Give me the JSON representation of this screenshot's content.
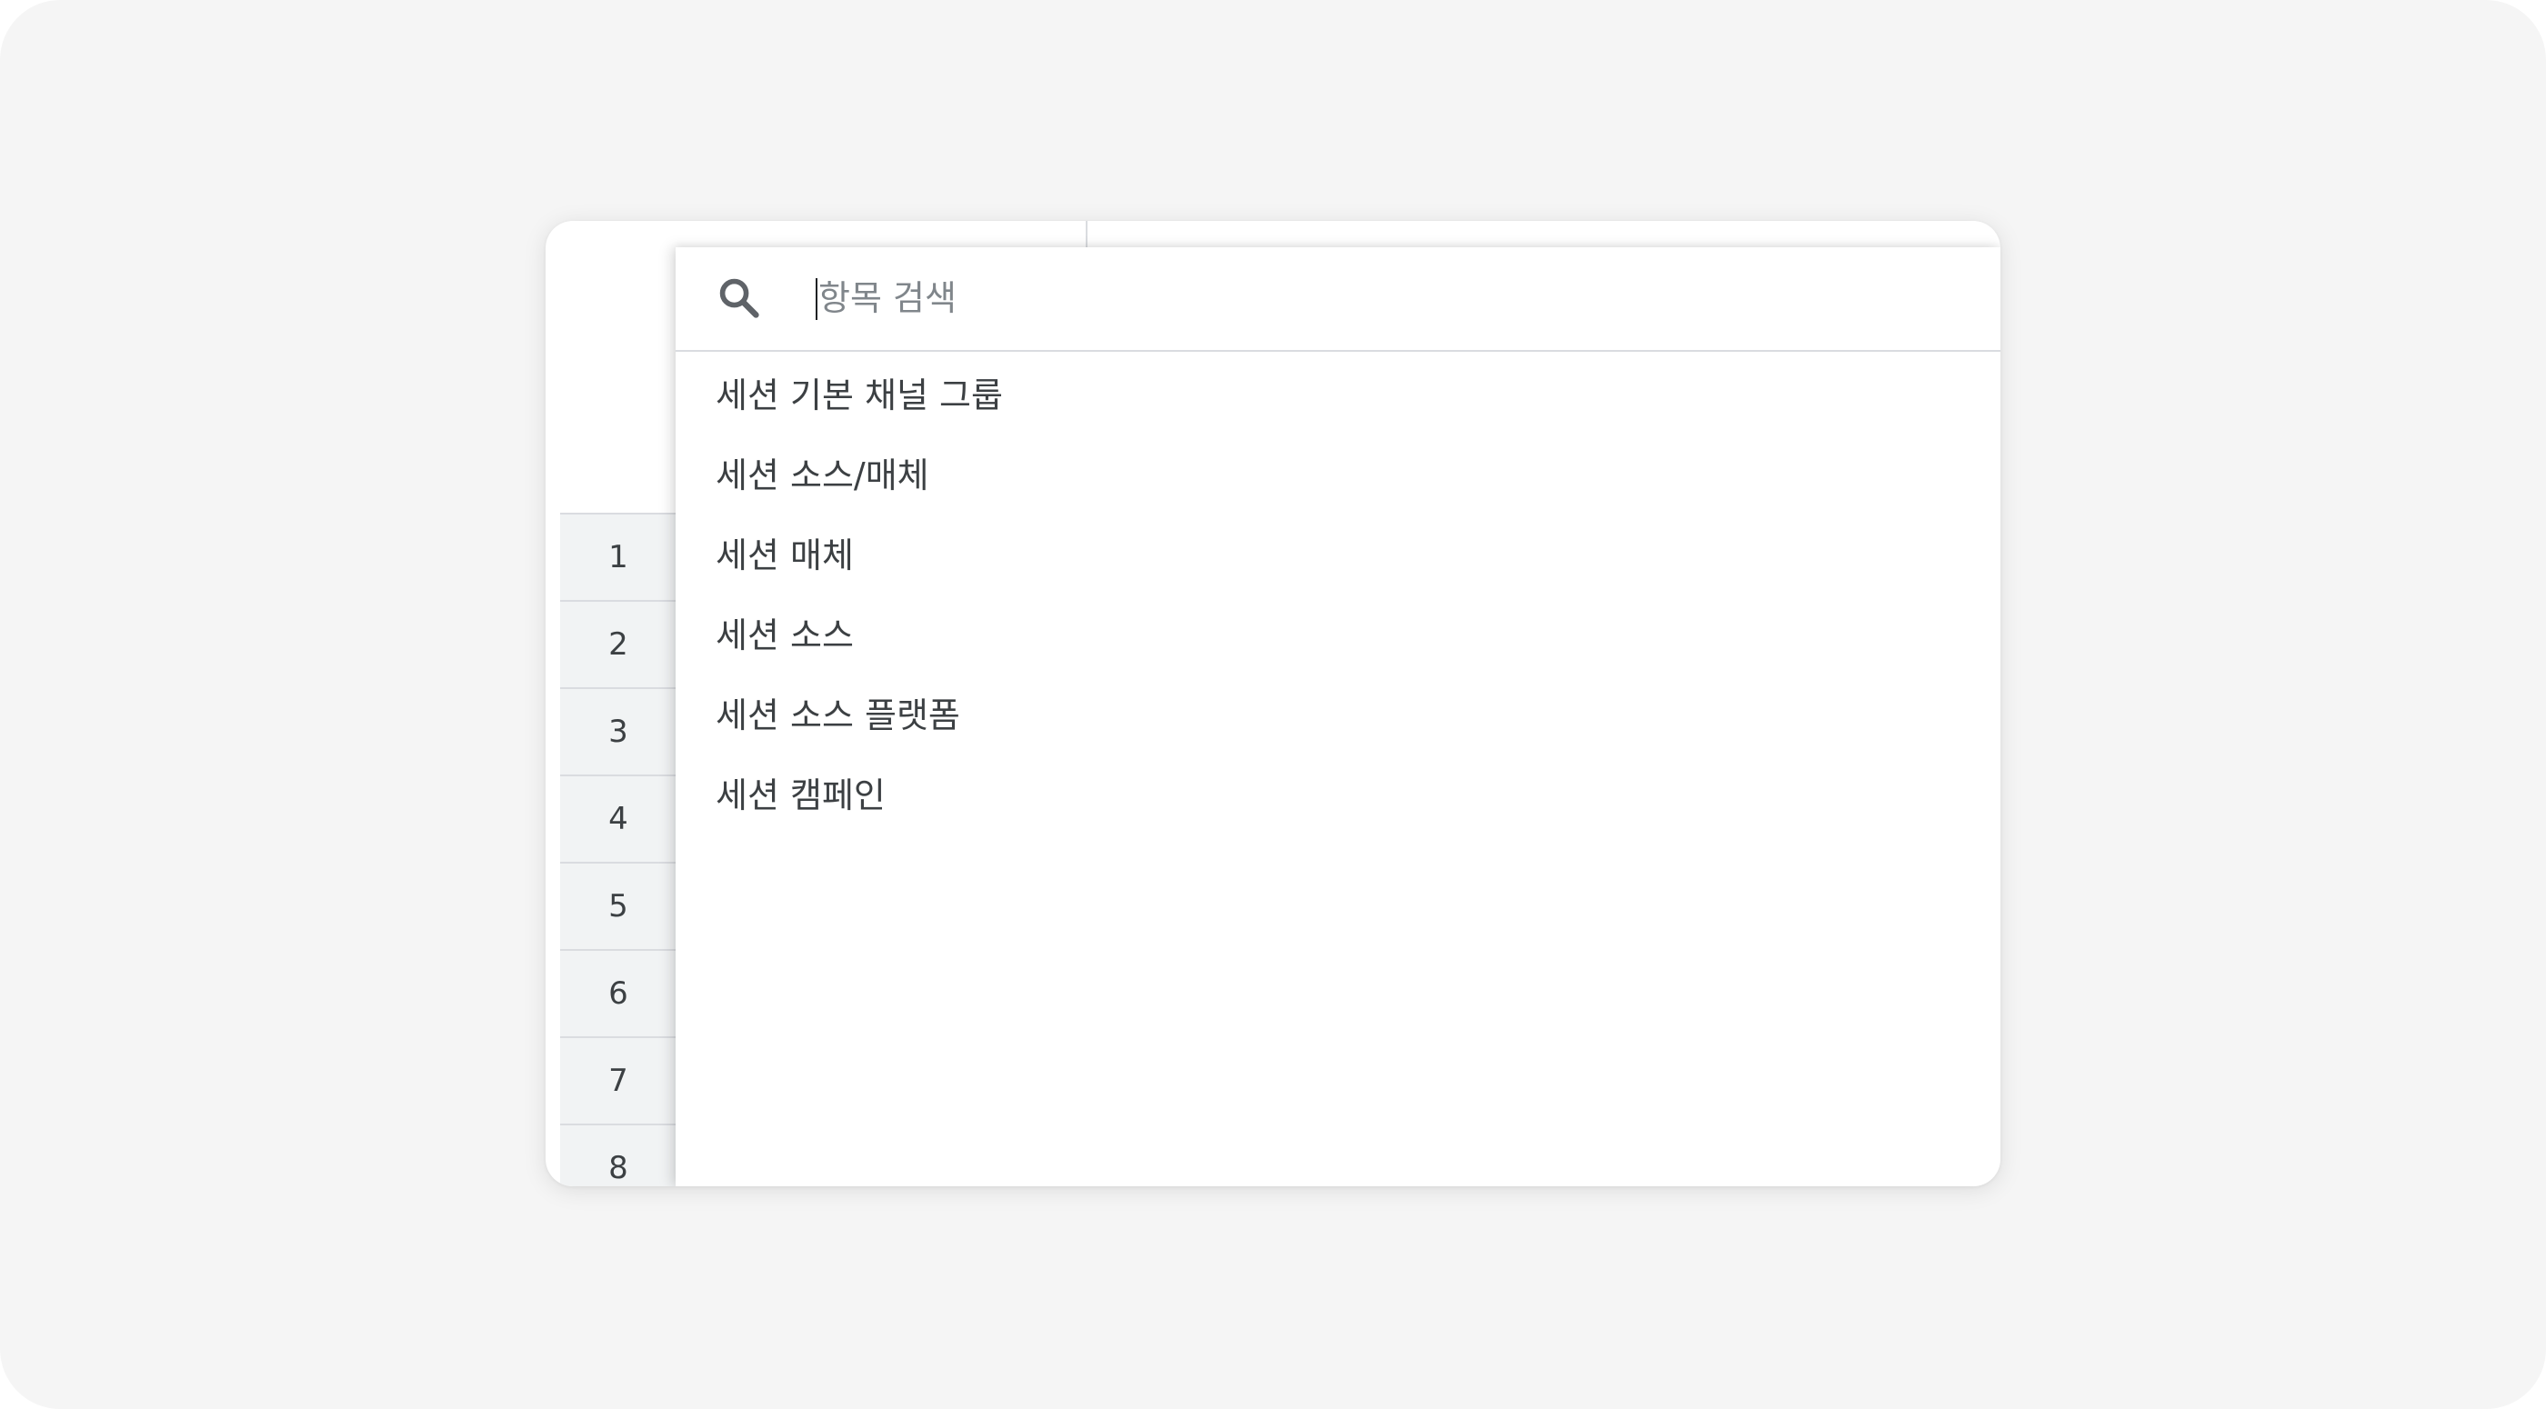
{
  "search": {
    "placeholder": "항목 검색",
    "value": ""
  },
  "row_numbers": [
    "1",
    "2",
    "3",
    "4",
    "5",
    "6",
    "7",
    "8"
  ],
  "dimension_options": [
    "세션 기본 채널 그룹",
    "세션 소스/매체",
    "세션 매체",
    "세션 소스",
    "세션 소스 플랫폼",
    "세션 캠페인"
  ],
  "icons": {
    "search": "search-icon"
  },
  "colors": {
    "text_primary": "#3c4043",
    "placeholder": "#80868b",
    "divider": "#dadce0",
    "row_header_bg": "#f1f3f4",
    "icon": "#5f6368"
  }
}
